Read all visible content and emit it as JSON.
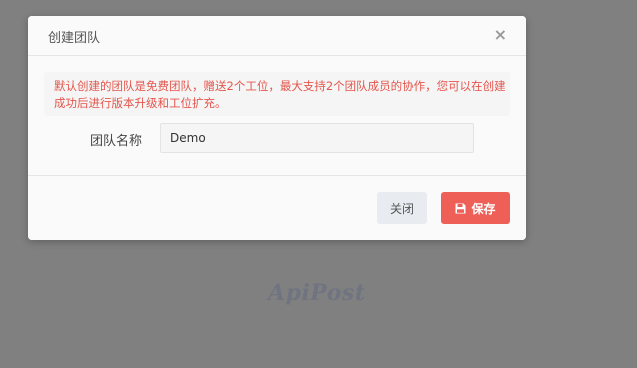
{
  "background": {
    "watermark_text": "ApiPost"
  },
  "modal": {
    "title": "创建团队",
    "close_symbol": "×",
    "notice": "默认创建的团队是免费团队，赠送2个工位，最大支持2个团队成员的协作，您可以在创建成功后进行版本升级和工位扩充。",
    "form": {
      "name_label": "团队名称",
      "name_value": "Demo"
    },
    "footer": {
      "close_label": "关闭",
      "save_label": "保存",
      "save_icon": "save-icon"
    }
  },
  "colors": {
    "overlay": "#808080",
    "notice_text": "#e4554c",
    "save_button": "#ee5f57",
    "close_button": "#e8ebef"
  }
}
